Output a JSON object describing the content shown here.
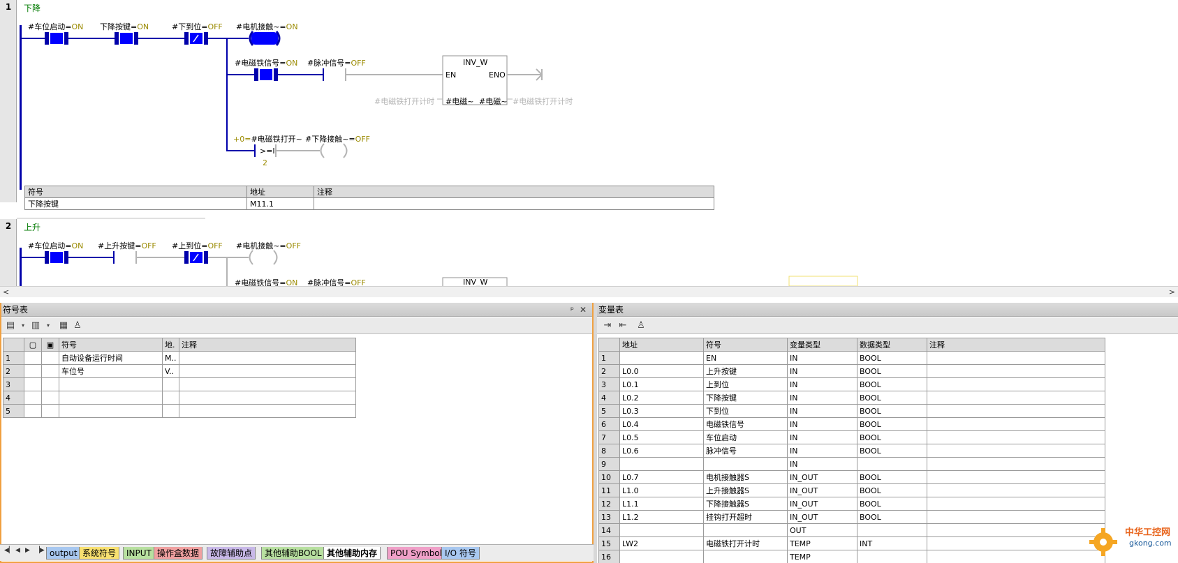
{
  "network1": {
    "number": "1",
    "title": "下降",
    "c1_name": "#车位启动=",
    "c1_state": "ON",
    "c2_name": "下降按键=",
    "c2_state": "ON",
    "c3_name": "#下到位=",
    "c3_state": "OFF",
    "coil1_name": "#电机接触~=",
    "coil1_state": "ON",
    "c4_name": "#电磁铁信号=",
    "c4_state": "ON",
    "c5_name": "#脉冲信号=",
    "c5_state": "OFF",
    "block_name": "INV_W",
    "block_en": "EN",
    "block_eno": "ENO",
    "block_in_param": "#电磁~",
    "block_out_param": "#电磁~",
    "block_in_var": "#电磁铁打开计时",
    "block_out_var": "#电磁铁打开计时",
    "cmp_prefix": "+0=",
    "cmp_name": "#电磁铁打开~",
    "cmp_op": ">=I",
    "cmp_value": "2",
    "coil2_name": "#下降接触~=",
    "coil2_state": "OFF",
    "table_headers": [
      "符号",
      "地址",
      "注释"
    ],
    "table_row": [
      "下降按键",
      "M11.1",
      ""
    ]
  },
  "network2": {
    "number": "2",
    "title": "上升",
    "c1_name": "#车位启动=",
    "c1_state": "ON",
    "c2_name": "#上升按键=",
    "c2_state": "OFF",
    "c3_name": "#上到位=",
    "c3_state": "OFF",
    "coil1_name": "#电机接触~=",
    "coil1_state": "OFF",
    "c4_name": "#电磁铁信号=",
    "c4_state": "ON",
    "c5_name": "#脉冲信号=",
    "c5_state": "OFF",
    "block_name": "INV_W"
  },
  "symbol_panel": {
    "title": "符号表",
    "pin": "ᵖ",
    "close": "✕",
    "headers": [
      "",
      "",
      "",
      "符号",
      "地.",
      "注释"
    ],
    "rows": [
      [
        "1",
        "自动设备运行时间",
        "M..",
        ""
      ],
      [
        "2",
        "车位号",
        "V..",
        ""
      ],
      [
        "3",
        "",
        "",
        ""
      ],
      [
        "4",
        "",
        "",
        ""
      ],
      [
        "5",
        "",
        "",
        ""
      ]
    ]
  },
  "variable_panel": {
    "title": "变量表",
    "headers": [
      "",
      "地址",
      "符号",
      "变量类型",
      "数据类型",
      "注释"
    ],
    "rows": [
      [
        "1",
        "",
        "EN",
        "IN",
        "BOOL",
        ""
      ],
      [
        "2",
        "L0.0",
        "上升按键",
        "IN",
        "BOOL",
        ""
      ],
      [
        "3",
        "L0.1",
        "上到位",
        "IN",
        "BOOL",
        ""
      ],
      [
        "4",
        "L0.2",
        "下降按键",
        "IN",
        "BOOL",
        ""
      ],
      [
        "5",
        "L0.3",
        "下到位",
        "IN",
        "BOOL",
        ""
      ],
      [
        "6",
        "L0.4",
        "电磁铁信号",
        "IN",
        "BOOL",
        ""
      ],
      [
        "7",
        "L0.5",
        "车位启动",
        "IN",
        "BOOL",
        ""
      ],
      [
        "8",
        "L0.6",
        "脉冲信号",
        "IN",
        "BOOL",
        ""
      ],
      [
        "9",
        "",
        "",
        "IN",
        "",
        ""
      ],
      [
        "10",
        "L0.7",
        "电机接触器S",
        "IN_OUT",
        "BOOL",
        ""
      ],
      [
        "11",
        "L1.0",
        "上升接触器S",
        "IN_OUT",
        "BOOL",
        ""
      ],
      [
        "12",
        "L1.1",
        "下降接触器S",
        "IN_OUT",
        "BOOL",
        ""
      ],
      [
        "13",
        "L1.2",
        "挂钩打开超时",
        "IN_OUT",
        "BOOL",
        ""
      ],
      [
        "14",
        "",
        "",
        "OUT",
        "",
        ""
      ],
      [
        "15",
        "LW2",
        "电磁铁打开计时",
        "TEMP",
        "INT",
        ""
      ],
      [
        "16",
        "",
        "",
        "TEMP",
        "",
        ""
      ]
    ]
  },
  "tabs": [
    {
      "label": "output",
      "color": "#a8c8f0"
    },
    {
      "label": "系统符号",
      "color": "#f8e070"
    },
    {
      "label": "INPUT",
      "color": "#b8e0a0"
    },
    {
      "label": "操作盒数据",
      "color": "#f0a0a0"
    },
    {
      "label": "故障辅助点",
      "color": "#c8b8e8"
    },
    {
      "label": "其他辅助BOOL",
      "color": "#b8e0a0"
    },
    {
      "label": "其他辅助内存",
      "color": "#ffffff"
    },
    {
      "label": "POU Symbols",
      "color": "#f0a0c8"
    },
    {
      "label": "I/O 符号",
      "color": "#a8c8f0"
    }
  ],
  "watermark": {
    "line1": "中华工控网",
    "line2": "gkong.com"
  }
}
